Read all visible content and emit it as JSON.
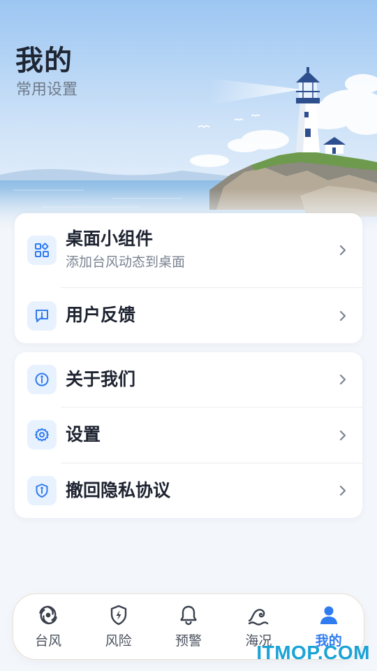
{
  "header": {
    "title": "我的",
    "subtitle": "常用设置"
  },
  "card_1": {
    "items": [
      {
        "label": "桌面小组件",
        "description": "添加台风动态到桌面",
        "icon": "widgets-icon"
      },
      {
        "label": "用户反馈",
        "icon": "feedback-icon"
      }
    ]
  },
  "card_2": {
    "items": [
      {
        "label": "关于我们",
        "icon": "info-icon"
      },
      {
        "label": "设置",
        "icon": "gear-icon"
      },
      {
        "label": "撤回隐私协议",
        "icon": "shield-info-icon"
      }
    ]
  },
  "bottom_nav": {
    "items": [
      {
        "label": "台风",
        "icon": "typhoon-icon",
        "active": false
      },
      {
        "label": "风险",
        "icon": "shield-bolt-icon",
        "active": false
      },
      {
        "label": "预警",
        "icon": "bell-icon",
        "active": false
      },
      {
        "label": "海况",
        "icon": "wave-icon",
        "active": false
      },
      {
        "label": "我的",
        "icon": "user-icon",
        "active": true
      }
    ]
  },
  "watermark": "ITMOP.COM",
  "colors": {
    "accent": "#2f7bf0",
    "icon_bg": "#e8f1fe",
    "page_bg": "#f3f6fa"
  }
}
